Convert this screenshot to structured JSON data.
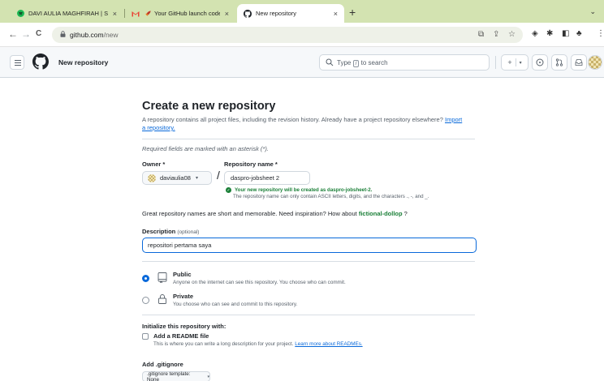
{
  "browser": {
    "tabs": [
      {
        "label": "DAVI AULIA MAGHFIRAH | Spo",
        "close": "×"
      },
      {
        "label": "Your GitHub launch code -",
        "close": "×"
      },
      {
        "label": "New repository",
        "close": "×"
      }
    ],
    "new_tab": "+",
    "tab_menu": "⌄",
    "nav": {
      "back": "←",
      "forward": "→",
      "reload": "C"
    },
    "url": {
      "host": "github.com",
      "path": "/new"
    }
  },
  "header": {
    "context": "New repository",
    "search": {
      "prefix": "Type",
      "key": "/",
      "suffix": "to search"
    },
    "plus": "+",
    "caret": "▾"
  },
  "form": {
    "title": "Create a new repository",
    "lead_text": "A repository contains all project files, including the revision history. Already have a project repository elsewhere?",
    "import_link": "Import a repository.",
    "required_note": "Required fields are marked with an asterisk (*).",
    "owner_label": "Owner *",
    "owner_value": "daviaulia08",
    "slash": "/",
    "repo_label": "Repository name *",
    "repo_value": "daspro-jobsheet 2",
    "repo_ok": "Your new repository will be created as daspro-jobsheet-2.",
    "repo_hint": "The repository name can only contain ASCII letters, digits, and the characters ., -, and _.",
    "inspire_text": "Great repository names are short and memorable. Need inspiration? How about",
    "inspire_name": "fictional-dollop",
    "inspire_end": "?",
    "desc_label": "Description",
    "desc_optional": "(optional)",
    "desc_value": "repositori pertama saya",
    "visibility": {
      "public_title": "Public",
      "public_desc": "Anyone on the internet can see this repository. You choose who can commit.",
      "private_title": "Private",
      "private_desc": "You choose who can see and commit to this repository.",
      "selected": "public"
    },
    "init_title": "Initialize this repository with:",
    "readme_title": "Add a README file",
    "readme_desc": "This is where you can write a long description for your project.",
    "readme_link": "Learn more about READMEs.",
    "gitignore_title": "Add .gitignore",
    "gitignore_value": ".gitignore template: None",
    "caret": "▾"
  }
}
